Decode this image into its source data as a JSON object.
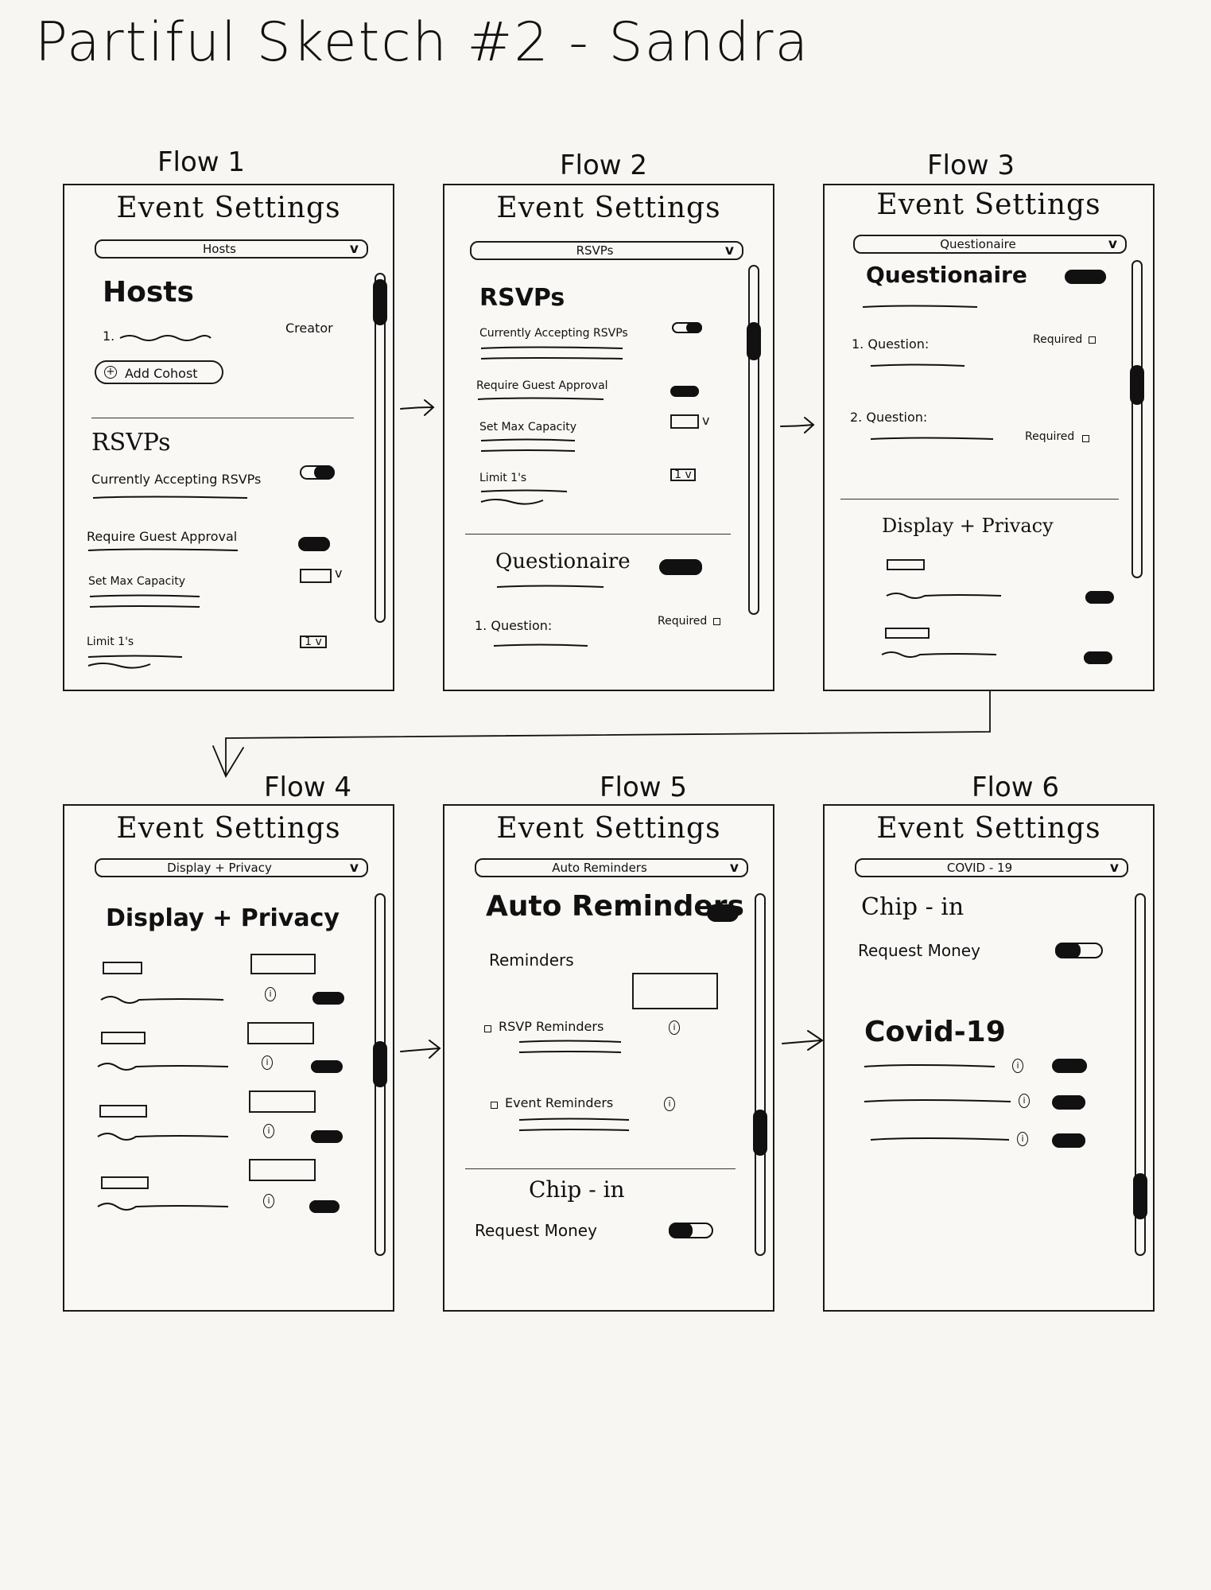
{
  "page_title": "Partiful Sketch #2 - Sandra",
  "flows": [
    {
      "label": "Flow 1",
      "heading": "Event Settings",
      "dropdown": "Hosts"
    },
    {
      "label": "Flow 2",
      "heading": "Event Settings",
      "dropdown": "RSVPs"
    },
    {
      "label": "Flow 3",
      "heading": "Event Settings",
      "dropdown": "Questionaire"
    },
    {
      "label": "Flow 4",
      "heading": "Event Settings",
      "dropdown": "Display + Privacy"
    },
    {
      "label": "Flow 5",
      "heading": "Event Settings",
      "dropdown": "Auto Reminders"
    },
    {
      "label": "Flow 6",
      "heading": "Event Settings",
      "dropdown": "COVID - 19"
    }
  ],
  "f1": {
    "hosts_title": "Hosts",
    "row_num": "1.",
    "creator": "Creator",
    "add_cohost": "Add Cohost",
    "rsvps_title": "RSVPs",
    "currently_accepting": "Currently Accepting RSVPs",
    "require_guest": "Require Guest Approval",
    "set_max": "Set Max Capacity",
    "limit": "Limit 1's",
    "limit_box": "1 v",
    "select_chev": "v"
  },
  "f2": {
    "rsvps_title": "RSVPs",
    "currently_accepting": "Currently Accepting RSVPs",
    "require_guest": "Require Guest Approval",
    "set_max": "Set Max Capacity",
    "limit": "Limit 1's",
    "limit_box": "1 v",
    "select_chev": "v",
    "questionnaire_title": "Questionaire",
    "q1": "1. Question:",
    "required": "Required"
  },
  "f3": {
    "questionnaire_title": "Questionaire",
    "q1": "1. Question:",
    "q2": "2. Question:",
    "required": "Required",
    "display_title": "Display + Privacy"
  },
  "f4": {
    "display_title": "Display + Privacy"
  },
  "f5": {
    "auto_title": "Auto Reminders",
    "reminders": "Reminders",
    "rsvp_reminders": "RSVP Reminders",
    "event_reminders": "Event Reminders",
    "chip_title": "Chip - in",
    "request_money": "Request Money"
  },
  "f6": {
    "chip_title": "Chip - in",
    "request_money": "Request Money",
    "covid_title": "Covid-19"
  },
  "info_glyph": "i",
  "plus_glyph": "+",
  "colors": {
    "ink": "#111111",
    "paper": "#f7f6f2"
  }
}
